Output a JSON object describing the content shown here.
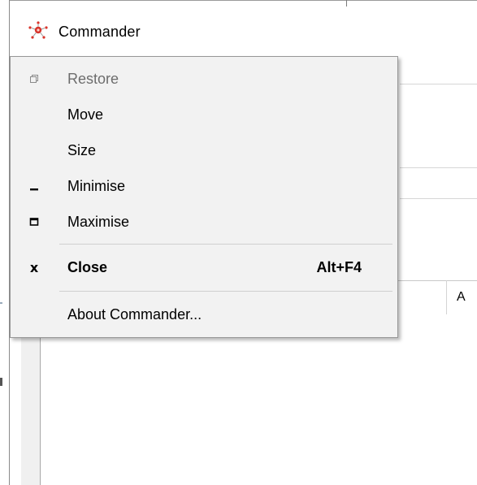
{
  "window": {
    "title": "Commander",
    "icon": "commander-app-icon",
    "list_column_header": "A"
  },
  "system_menu": {
    "items": [
      {
        "label": "Restore",
        "icon": "restore-icon",
        "enabled": false
      },
      {
        "label": "Move",
        "icon": "",
        "enabled": true
      },
      {
        "label": "Size",
        "icon": "",
        "enabled": true
      },
      {
        "label": "Minimise",
        "icon": "minimise-icon",
        "enabled": true
      },
      {
        "label": "Maximise",
        "icon": "maximise-icon",
        "enabled": true
      },
      {
        "label": "Close",
        "icon": "close-icon",
        "enabled": true,
        "bold": true,
        "accelerator": "Alt+F4"
      },
      {
        "label": "About Commander...",
        "icon": "",
        "enabled": true
      }
    ]
  },
  "colors": {
    "menu_background": "#f2f2f2",
    "menu_border": "#979797",
    "disabled_text": "#6d6d6d",
    "icon_red": "#d9342b"
  }
}
